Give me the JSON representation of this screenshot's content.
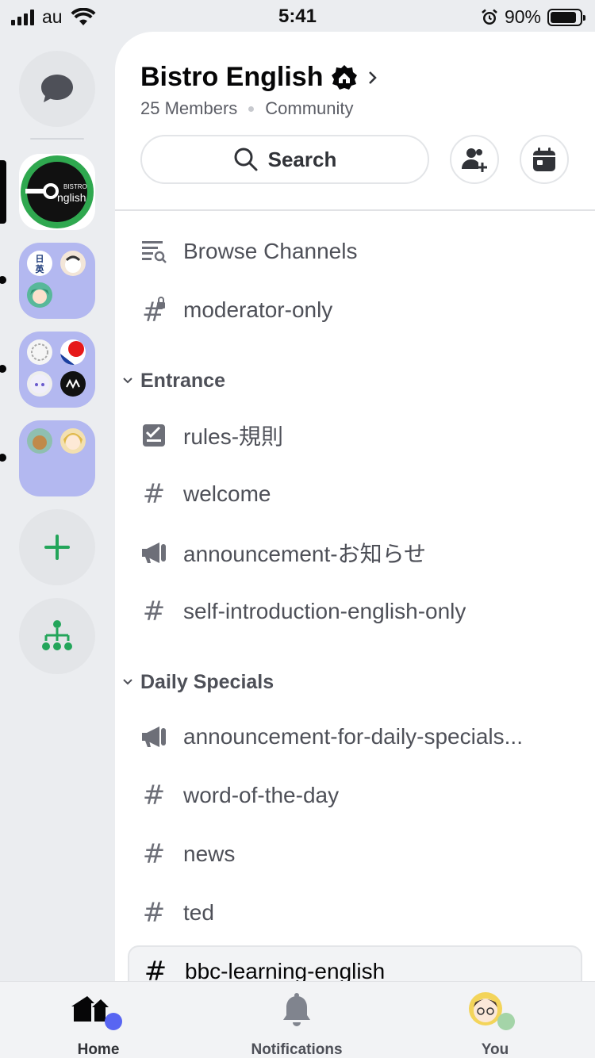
{
  "status_bar": {
    "carrier": "au",
    "time": "5:41",
    "battery_percent": "90%",
    "battery_level": 0.9
  },
  "server": {
    "name": "Bistro English",
    "members": "25 Members",
    "type": "Community"
  },
  "header": {
    "search_label": "Search"
  },
  "server_icon_text": "BISTRO English",
  "channels_top": [
    {
      "icon": "browse-channels-icon",
      "label": "Browse Channels"
    },
    {
      "icon": "locked-hash-icon",
      "label": "moderator-only"
    }
  ],
  "categories": [
    {
      "name": "Entrance",
      "channels": [
        {
          "icon": "rules-checkbox-icon",
          "label": "rules-規則"
        },
        {
          "icon": "hash-icon",
          "label": "welcome"
        },
        {
          "icon": "megaphone-icon",
          "label": "announcement-お知らせ"
        },
        {
          "icon": "hash-icon",
          "label": "self-introduction-english-only"
        }
      ]
    },
    {
      "name": "Daily Specials",
      "channels": [
        {
          "icon": "megaphone-icon",
          "label": "announcement-for-daily-specials..."
        },
        {
          "icon": "hash-icon",
          "label": "word-of-the-day"
        },
        {
          "icon": "hash-icon",
          "label": "news"
        },
        {
          "icon": "hash-icon",
          "label": "ted"
        },
        {
          "icon": "hash-icon",
          "label": "bbc-learning-english"
        }
      ]
    }
  ],
  "bottom_nav": {
    "home": "Home",
    "notifications": "Notifications",
    "you": "You"
  },
  "colors": {
    "accent_green": "#23a55a",
    "home_badge": "#5865f2",
    "status_online": "#a4d4a8",
    "folder_bg": "#b3b8f0"
  }
}
